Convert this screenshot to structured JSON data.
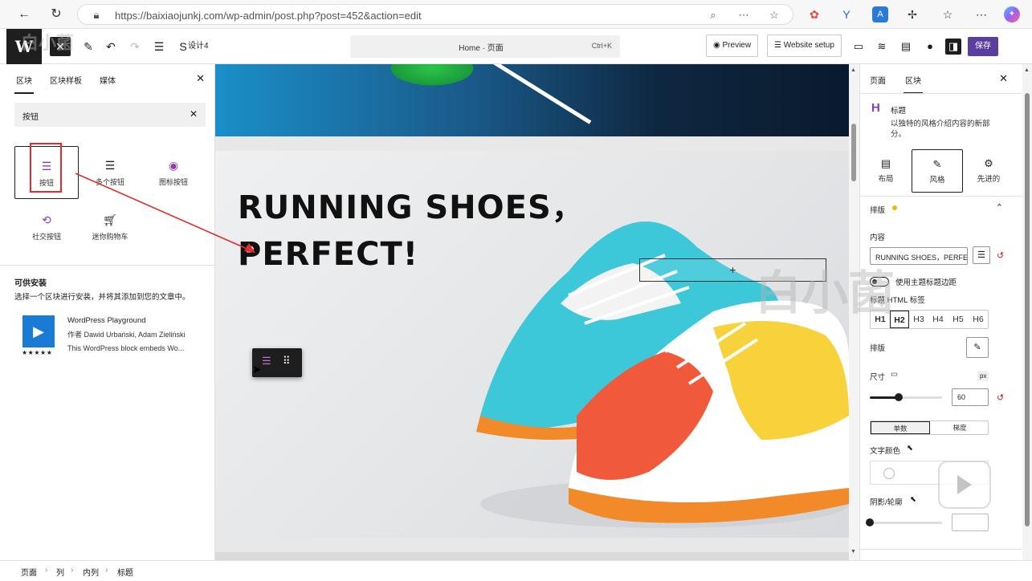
{
  "browser": {
    "url": "https://baixiaojunkj.com/wp-admin/post.php?post=452&action=edit"
  },
  "toolbar": {
    "wp_logo": "W",
    "doc_label": "设计4",
    "command_title": "Home · 页面",
    "command_shortcut": "Ctrl+K",
    "preview_label": "Preview",
    "website_setup_label": "Website setup",
    "save_label": "保存"
  },
  "inserter": {
    "tabs": [
      "区块",
      "区块样板",
      "媒体"
    ],
    "search_value": "按钮",
    "blocks": [
      {
        "label": "按钮",
        "icon": "buttons-icon"
      },
      {
        "label": "多个按钮",
        "icon": "multi-buttons-icon"
      },
      {
        "label": "图标按钮",
        "icon": "icon-button-icon"
      },
      {
        "label": "社交按钮",
        "icon": "share-icon"
      },
      {
        "label": "迷你购物车",
        "icon": "cart-icon"
      }
    ],
    "install_title": "可供安装",
    "install_desc": "选择一个区块进行安装，并将其添加到您的文章中。",
    "plugin": {
      "name": "WordPress Playground",
      "author": "作者 Dawid Urbański, Adam Zieliński",
      "desc": "This WordPress block embeds Wo...",
      "stars": "★★★★★"
    }
  },
  "canvas": {
    "heading_line1": "RUNNING SHOES，",
    "heading_line2": "PERFECT!",
    "button_placeholder": "+"
  },
  "breadcrumb": [
    "页面",
    "列",
    "内列",
    "标题"
  ],
  "settings": {
    "tabs": [
      "页面",
      "区块"
    ],
    "block_icon": "H",
    "block_title": "标题",
    "block_desc": "以独特的风格介绍内容的新部分。",
    "style_tabs": [
      {
        "label": "布局",
        "icon": "▤"
      },
      {
        "label": "风格",
        "icon": "✎"
      },
      {
        "label": "先进的",
        "icon": "⚙"
      }
    ],
    "section_typography": "排版",
    "content_label": "内容",
    "content_value": "RUNNING SHOES，PERFE",
    "toggle_label": "使用主题标题边距",
    "html_tag_label": "标题 HTML 标签",
    "heading_levels": [
      "H1",
      "H2",
      "H3",
      "H4",
      "H5",
      "H6"
    ],
    "active_level": "H2",
    "typography_label": "排版",
    "size_label": "尺寸",
    "size_unit": "px",
    "size_value": "60",
    "size_fraction": 0.4,
    "seg_options": [
      "单数",
      "梯度"
    ],
    "text_color_label": "文字颜色",
    "shadow_label": "阴影/轮廓",
    "shadow_fraction": 0.0
  },
  "colors": {
    "save": "#5a3fa0",
    "accent_purple": "#8a3fb0",
    "annotation_red": "#e52b2b"
  }
}
